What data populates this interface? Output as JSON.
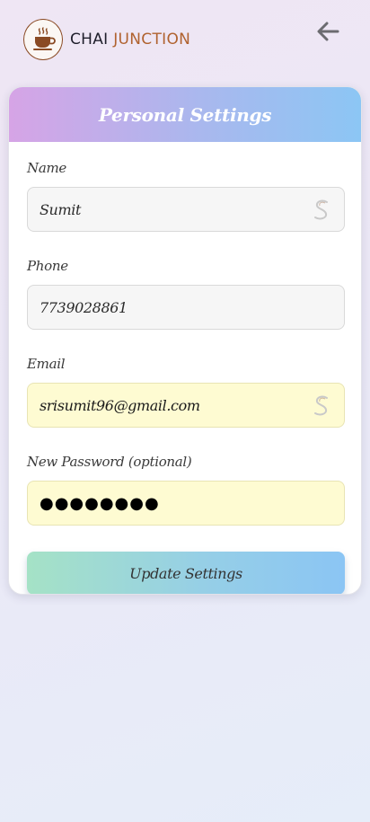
{
  "brand": {
    "name_part1": "CHAI",
    "name_part2": "JUNCTION"
  },
  "header": {
    "back_icon": "arrow-left-icon"
  },
  "settings": {
    "title": "Personal Settings",
    "name": {
      "label": "Name",
      "value": "Sumit"
    },
    "phone": {
      "label": "Phone",
      "value": "7739028861"
    },
    "email": {
      "label": "Email",
      "value": "srisumit96@gmail.com"
    },
    "password": {
      "label": "New Password (optional)",
      "value": "●●●●●●●●"
    },
    "submit_label": "Update Settings"
  },
  "colors": {
    "brand_dark": "#1f1f2b",
    "brand_accent": "#b0622f",
    "header_gradient_start": "#d6a4e6",
    "header_gradient_end": "#8cc6f4",
    "autofill_background": "#fefbd2",
    "button_gradient_start": "#a5e2c6",
    "button_gradient_end": "#8bc5f4"
  }
}
